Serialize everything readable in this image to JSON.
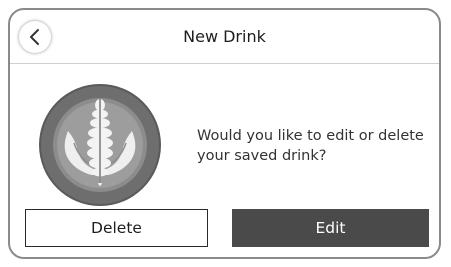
{
  "header": {
    "title": "New Drink",
    "back_icon": "chevron-left-icon"
  },
  "main": {
    "image_icon": "latte-art-icon",
    "message": "Would you like to edit or delete your saved drink?"
  },
  "actions": {
    "delete_label": "Delete",
    "edit_label": "Edit"
  },
  "colors": {
    "frame_border": "#8a8a8a",
    "edit_button_bg": "#4a4a4a",
    "delete_button_border": "#2a2a2a",
    "text": "#1e1e1e"
  }
}
